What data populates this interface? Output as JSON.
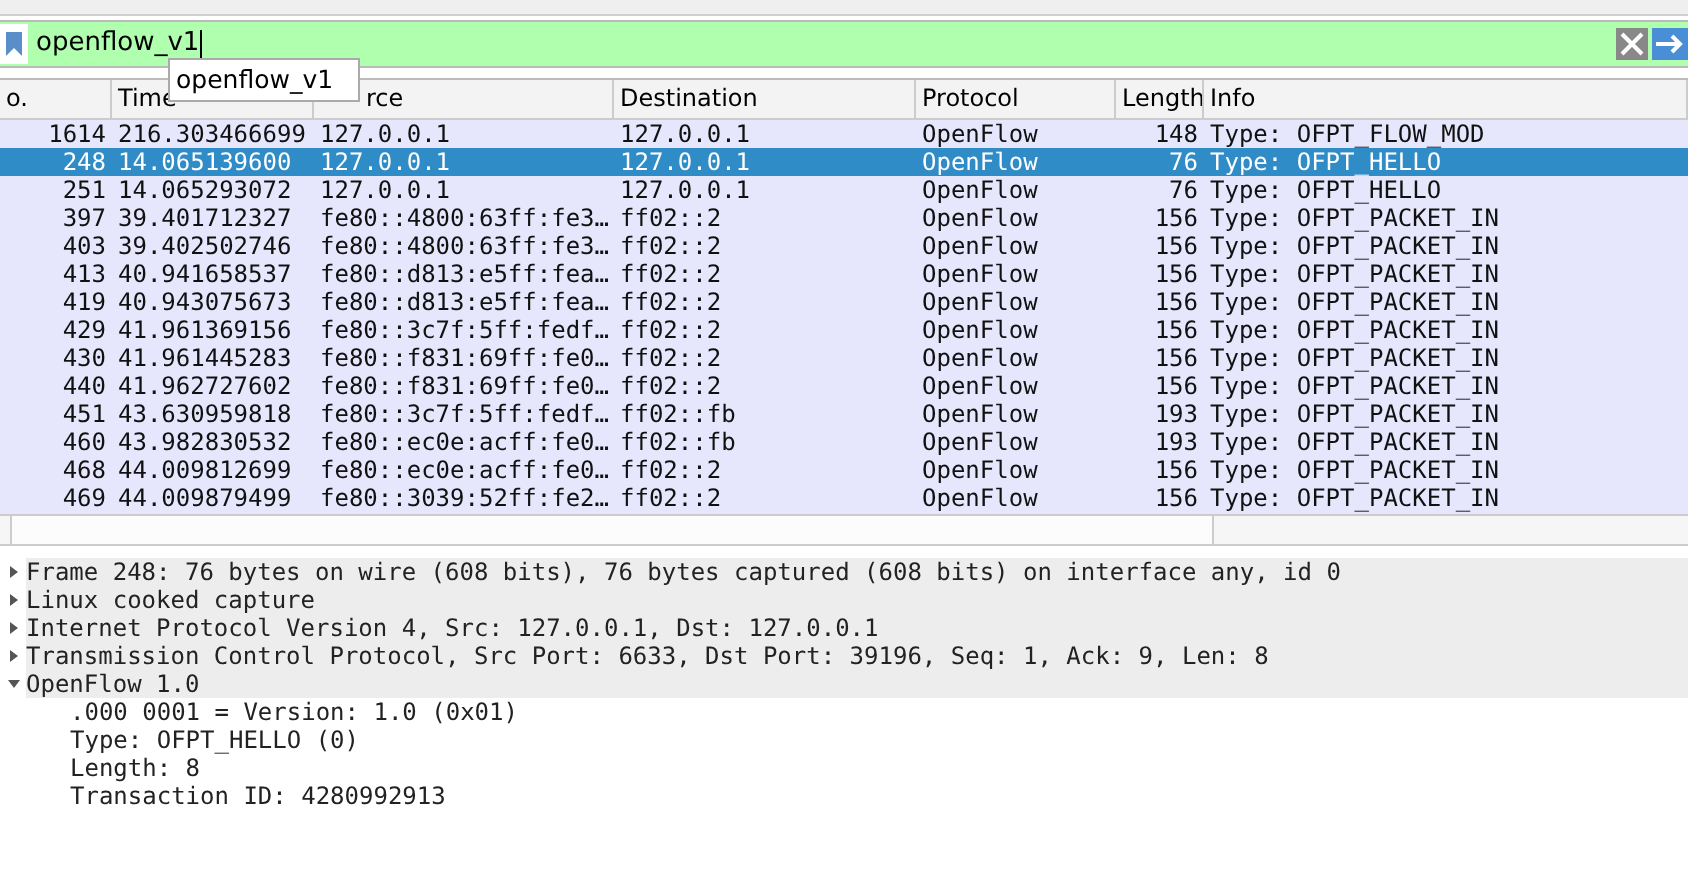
{
  "filter": {
    "value": "openflow_v1",
    "suggestions": [
      "openflow_v1"
    ]
  },
  "packet_list": {
    "columns": [
      "o.",
      "Time",
      "rce",
      "Destination",
      "Protocol",
      "Length",
      "Info"
    ],
    "rows": [
      {
        "cells": [
          "1614",
          "216.303466699",
          "127.0.0.1",
          "127.0.0.1",
          "OpenFlow",
          "148",
          "Type: OFPT_FLOW_MOD"
        ],
        "selected": false
      },
      {
        "cells": [
          "248",
          "14.065139600",
          "127.0.0.1",
          "127.0.0.1",
          "OpenFlow",
          "76",
          "Type: OFPT_HELLO"
        ],
        "selected": true
      },
      {
        "cells": [
          "251",
          "14.065293072",
          "127.0.0.1",
          "127.0.0.1",
          "OpenFlow",
          "76",
          "Type: OFPT_HELLO"
        ],
        "selected": false
      },
      {
        "cells": [
          "397",
          "39.401712327",
          "fe80::4800:63ff:fe3…",
          "ff02::2",
          "OpenFlow",
          "156",
          "Type: OFPT_PACKET_IN"
        ],
        "selected": false
      },
      {
        "cells": [
          "403",
          "39.402502746",
          "fe80::4800:63ff:fe3…",
          "ff02::2",
          "OpenFlow",
          "156",
          "Type: OFPT_PACKET_IN"
        ],
        "selected": false
      },
      {
        "cells": [
          "413",
          "40.941658537",
          "fe80::d813:e5ff:fea…",
          "ff02::2",
          "OpenFlow",
          "156",
          "Type: OFPT_PACKET_IN"
        ],
        "selected": false
      },
      {
        "cells": [
          "419",
          "40.943075673",
          "fe80::d813:e5ff:fea…",
          "ff02::2",
          "OpenFlow",
          "156",
          "Type: OFPT_PACKET_IN"
        ],
        "selected": false
      },
      {
        "cells": [
          "429",
          "41.961369156",
          "fe80::3c7f:5ff:fedf…",
          "ff02::2",
          "OpenFlow",
          "156",
          "Type: OFPT_PACKET_IN"
        ],
        "selected": false
      },
      {
        "cells": [
          "430",
          "41.961445283",
          "fe80::f831:69ff:fe0…",
          "ff02::2",
          "OpenFlow",
          "156",
          "Type: OFPT_PACKET_IN"
        ],
        "selected": false
      },
      {
        "cells": [
          "440",
          "41.962727602",
          "fe80::f831:69ff:fe0…",
          "ff02::2",
          "OpenFlow",
          "156",
          "Type: OFPT_PACKET_IN"
        ],
        "selected": false
      },
      {
        "cells": [
          "451",
          "43.630959818",
          "fe80::3c7f:5ff:fedf…",
          "ff02::fb",
          "OpenFlow",
          "193",
          "Type: OFPT_PACKET_IN"
        ],
        "selected": false
      },
      {
        "cells": [
          "460",
          "43.982830532",
          "fe80::ec0e:acff:fe0…",
          "ff02::fb",
          "OpenFlow",
          "193",
          "Type: OFPT_PACKET_IN"
        ],
        "selected": false
      },
      {
        "cells": [
          "468",
          "44.009812699",
          "fe80::ec0e:acff:fe0…",
          "ff02::2",
          "OpenFlow",
          "156",
          "Type: OFPT_PACKET_IN"
        ],
        "selected": false
      },
      {
        "cells": [
          "469",
          "44.009879499",
          "fe80::3039:52ff:fe2…",
          "ff02::2",
          "OpenFlow",
          "156",
          "Type: OFPT_PACKET_IN"
        ],
        "selected": false
      }
    ]
  },
  "details": [
    {
      "label": "Frame 248: 76 bytes on wire (608 bits), 76 bytes captured (608 bits) on interface any, id 0",
      "expanded": false
    },
    {
      "label": "Linux cooked capture",
      "expanded": false
    },
    {
      "label": "Internet Protocol Version 4, Src: 127.0.0.1, Dst: 127.0.0.1",
      "expanded": false
    },
    {
      "label": "Transmission Control Protocol, Src Port: 6633, Dst Port: 39196, Seq: 1, Ack: 9, Len: 8",
      "expanded": false
    },
    {
      "label": "OpenFlow 1.0",
      "expanded": true,
      "children": [
        {
          "label": ".000 0001 = Version: 1.0 (0x01)"
        },
        {
          "label": "Type: OFPT_HELLO (0)"
        },
        {
          "label": "Length: 8"
        },
        {
          "label": "Transaction ID: 4280992913"
        }
      ]
    }
  ]
}
